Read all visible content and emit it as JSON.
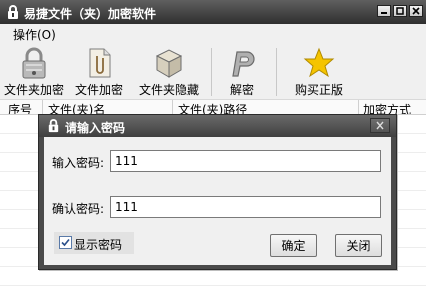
{
  "window": {
    "title": "易捷文件（夹）加密软件",
    "controls": {
      "minimize": "minimize-icon",
      "maximize": "maximize-icon",
      "close": "close-icon"
    }
  },
  "menu": {
    "items": [
      {
        "label": "操作(O)"
      }
    ]
  },
  "toolbar": {
    "buttons": [
      {
        "label": "文件夹加密",
        "icon": "padlock-icon"
      },
      {
        "label": "文件加密",
        "icon": "file-clip-icon"
      },
      {
        "label": "文件夹隐藏",
        "icon": "box-icon"
      },
      {
        "label": "解密",
        "icon": "decrypt-p-icon"
      },
      {
        "label": "购买正版",
        "icon": "star-icon"
      }
    ]
  },
  "table": {
    "columns": [
      "序号",
      "文件(夹)名",
      "文件(夹)路径",
      "加密方式"
    ]
  },
  "dialog": {
    "title": "请输入密码",
    "password_label": "输入密码:",
    "password_value": "111",
    "confirm_label": "确认密码:",
    "confirm_value": "111",
    "show_password_label": "显示密码",
    "show_password_checked": true,
    "ok_label": "确定",
    "cancel_label": "关闭"
  },
  "colors": {
    "titlebar": "#3a3a3a",
    "dialog_frame": "#4a4a4a",
    "panel": "#f0f0f0",
    "star": "#f5c400"
  }
}
